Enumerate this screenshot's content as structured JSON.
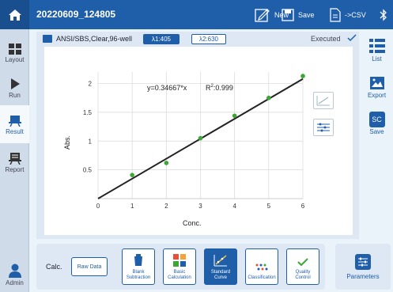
{
  "app": {
    "doc_title": "20220609_124805",
    "toolbar": {
      "new_label": "New",
      "save_label": "Save",
      "csv_label": "->CSV"
    }
  },
  "sidebar": {
    "items": [
      {
        "label": "Layout",
        "icon": "layout-icon"
      },
      {
        "label": "Run",
        "icon": "run-icon"
      },
      {
        "label": "Result",
        "icon": "result-icon"
      },
      {
        "label": "Report",
        "icon": "report-icon"
      }
    ],
    "user_label": "Admin"
  },
  "right_sidebar": {
    "list_label": "List",
    "export_label": "Export",
    "save_label": "Save",
    "sc_text": "SC"
  },
  "plate": {
    "name": "ANSI/SBS,Clear,96-well",
    "wavelength1": "λ1:405",
    "wavelength2": "λ2:630",
    "status": "Executed"
  },
  "chart_data": {
    "type": "scatter",
    "equation": "y=0.34667*x",
    "r2_label": "R",
    "r2_sup": "2",
    "r2_value": ":0.999",
    "xlabel": "Conc.",
    "ylabel": "Abs.",
    "xlim": [
      0,
      6
    ],
    "ylim": [
      0,
      2.2
    ],
    "x_ticks": [
      "0",
      "1",
      "2",
      "3",
      "4",
      "5",
      "6"
    ],
    "y_ticks": [
      "0.5",
      "1",
      "1.5",
      "2"
    ],
    "y_tick_values": [
      0.5,
      1,
      1.5,
      2
    ],
    "x": [
      1,
      2,
      3,
      4,
      5,
      6
    ],
    "y": [
      0.41,
      0.62,
      1.05,
      1.44,
      1.75,
      2.13
    ],
    "fit_slope": 0.34667,
    "point_color": "#3aa832",
    "line_color": "#222222",
    "grid": true
  },
  "calc": {
    "label": "Calc.",
    "raw_data": "Raw Data",
    "buttons": [
      {
        "line1": "Blank",
        "line2": "Subtraction",
        "icon": "blank-subtraction-icon",
        "active": false
      },
      {
        "line1": "Basic",
        "line2": "Calculation",
        "icon": "basic-calculation-icon",
        "active": false
      },
      {
        "line1": "Standard",
        "line2": "Curve",
        "icon": "standard-curve-icon",
        "active": true
      },
      {
        "line1": "Classification",
        "line2": "",
        "icon": "classification-icon",
        "active": false
      },
      {
        "line1": "Quality",
        "line2": "Control",
        "icon": "quality-control-icon",
        "active": false
      }
    ],
    "parameters_label": "Parameters"
  },
  "colors": {
    "brand": "#1f5ea8",
    "accent_green": "#3aa832"
  }
}
